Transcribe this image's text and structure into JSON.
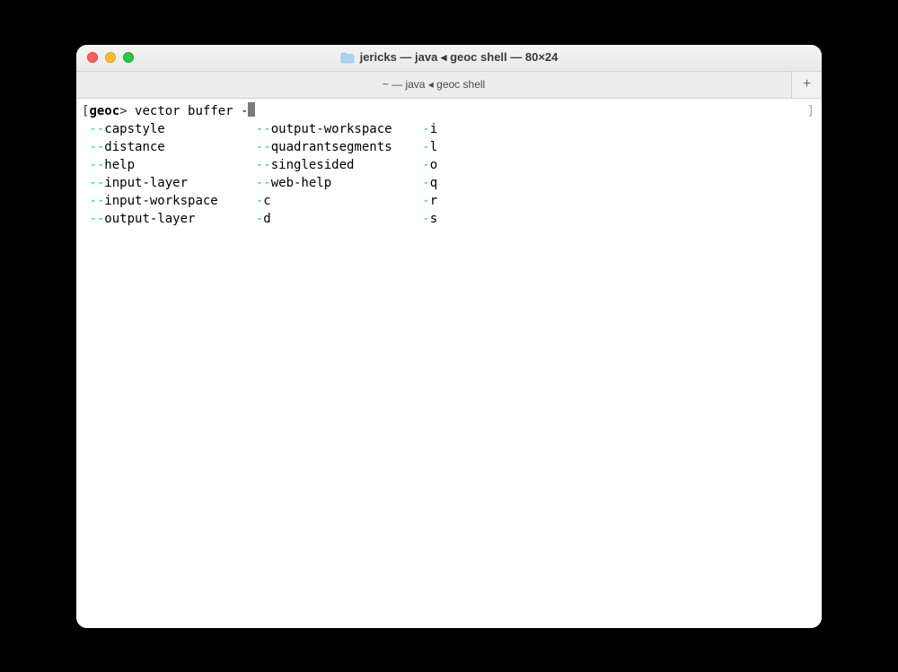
{
  "window": {
    "title": "jericks — java ◂ geoc shell — 80×24"
  },
  "tab": {
    "label": "~ — java ◂ geoc shell"
  },
  "newtab_label": "+",
  "prompt": {
    "open_bracket": "[",
    "name": "geoc",
    "gt": ">",
    "command": "vector buffer -",
    "close_bracket": "]"
  },
  "completions": {
    "col1": [
      {
        "d": "--",
        "n": "capstyle"
      },
      {
        "d": "--",
        "n": "distance"
      },
      {
        "d": "--",
        "n": "help"
      },
      {
        "d": "--",
        "n": "input-layer"
      },
      {
        "d": "--",
        "n": "input-workspace"
      },
      {
        "d": "--",
        "n": "output-layer"
      }
    ],
    "col2": [
      {
        "d": "--",
        "n": "output-workspace"
      },
      {
        "d": "--",
        "n": "quadrantsegments"
      },
      {
        "d": "--",
        "n": "singlesided"
      },
      {
        "d": "--",
        "n": "web-help"
      },
      {
        "d": "-",
        "n": "c"
      },
      {
        "d": "-",
        "n": "d"
      }
    ],
    "col3": [
      {
        "d": "-",
        "n": "i"
      },
      {
        "d": "-",
        "n": "l"
      },
      {
        "d": "-",
        "n": "o"
      },
      {
        "d": "-",
        "n": "q"
      },
      {
        "d": "-",
        "n": "r"
      },
      {
        "d": "-",
        "n": "s"
      }
    ]
  }
}
